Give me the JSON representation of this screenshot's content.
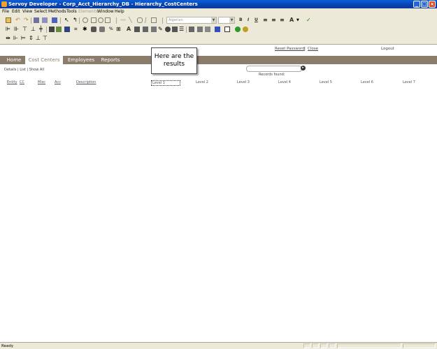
{
  "window": {
    "title": "Servoy Developer - Corp_Acct_Hierarchy_DB - Hierarchy_CostCenters"
  },
  "menu": [
    "File",
    "Edit",
    "View",
    "Select",
    "Methods",
    "Tools",
    "Elements",
    "Window",
    "Help"
  ],
  "menu_disabled": "Elements",
  "toolbar": {
    "font_name": "Algerian",
    "bold": "B",
    "italic": "I",
    "underline": "U",
    "text_tool": "A"
  },
  "header_links": {
    "reset_password": "Reset Password",
    "separator": "|",
    "close": "Close",
    "logout": "Logout"
  },
  "nav_tabs": [
    "Home",
    "Cost Centers",
    "Employees",
    "Reports"
  ],
  "active_tab": "Cost Centers",
  "view_modes": "Details | List | Show All",
  "records_found": "Records found:",
  "columns": [
    "Entity",
    "CC",
    "Misc",
    "Acc",
    "Description",
    "Level 1",
    "Level 2",
    "Level 3",
    "Level 4",
    "Level 5",
    "Level 6",
    "Level 7"
  ],
  "callout": "Here are the results",
  "status": {
    "text": "Ready"
  }
}
